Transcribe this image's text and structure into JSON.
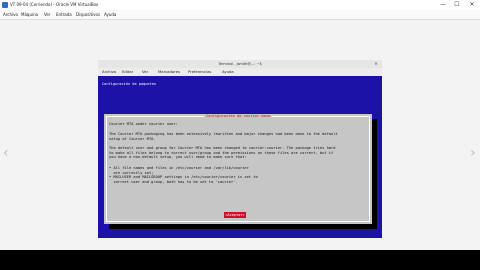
{
  "host": {
    "title": "VT 09-04 (Corriendo) - Oracle VM VirtualBox",
    "menu": [
      "Archivo",
      "Máquina",
      "Ver",
      "Entrada",
      "Dispositivos",
      "Ayuda"
    ],
    "min": "—",
    "max": "☐",
    "close": "✕"
  },
  "vm": {
    "title": "Terminal - jsmith@...: ~$ ",
    "menu": [
      "Archivo",
      "Editar",
      "Ver",
      "Marcadores",
      "Preferencias",
      "Ayuda"
    ],
    "close": "✕"
  },
  "terminal": {
    "package_line": "Configuración de paquetes"
  },
  "dialog": {
    "title": "Configuración de courier-base",
    "heading": "Courier MTA under courier user:",
    "para1": [
      "The Courier MTA packaging has been extensively rewritten and major changes had been done to the default",
      "setup of Courier MTA."
    ],
    "para2": [
      "The default user and group for Courier MTA has been changed to courier:courier. The package tries hard",
      "to make all files belong to correct user/group and the permissions on those files are correct, but if",
      "you have a non-default setup, you will need to make sure that:"
    ],
    "bullets": [
      "• All file names and files in /etc/courier and /var/lib/courier",
      "  are correctly set;",
      "• MAILUSER and MAILGROUP settings in /etc/courier/courier is set to",
      "  correct user and group, both has to be set to 'courier'."
    ],
    "ok_label": "<Aceptar>"
  },
  "nav": {
    "prev": "‹",
    "next": "›"
  }
}
